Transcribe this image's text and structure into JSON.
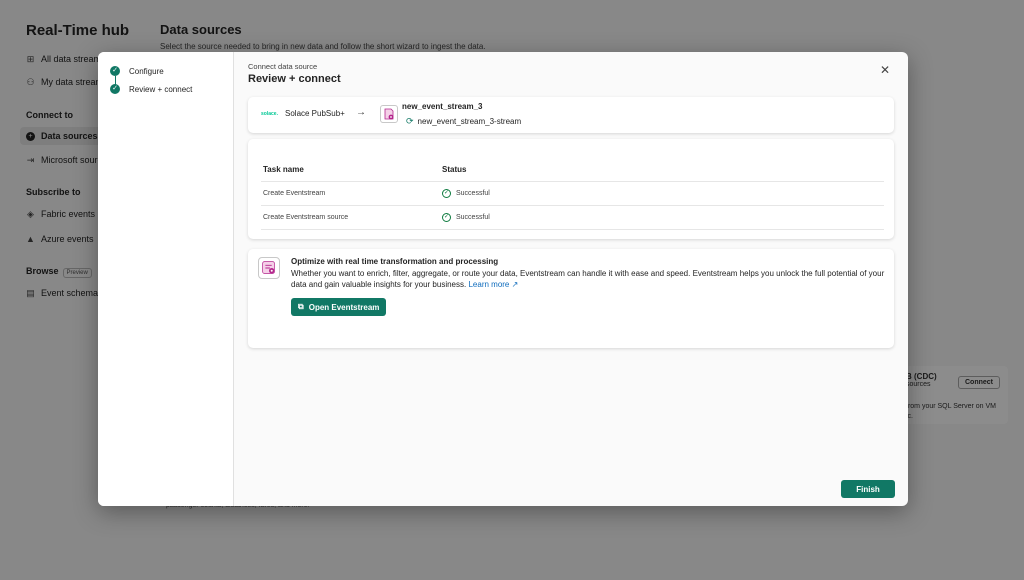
{
  "background": {
    "hub_title": "Real-Time hub",
    "nav": {
      "all_data_streams": "All data streams",
      "my_data_streams": "My data streams",
      "connect_to": "Connect to",
      "data_sources": "Data sources",
      "microsoft_sources": "Microsoft sources",
      "subscribe_to": "Subscribe to",
      "fabric_events": "Fabric events",
      "azure_events": "Azure events",
      "browse": "Browse",
      "preview_tag": "Preview",
      "event_schema": "Event schema re"
    },
    "page_title": "Data sources",
    "page_subtitle": "Select the source needed to bring in new data and follow the short wizard to ingest the data.",
    "card": {
      "title": "B (CDC)",
      "subtitle": "sources",
      "connect": "Connect",
      "desc_line1": "from your SQL Server on VM",
      "desc_line2": "ic."
    },
    "snippet": "passenger counts, distances, fares, and more."
  },
  "dialog": {
    "steps": [
      "Configure",
      "Review + connect"
    ],
    "kicker": "Connect data source",
    "title": "Review + connect",
    "source": {
      "logo_text": "solace.",
      "name": "Solace PubSub+"
    },
    "destination": {
      "name": "new_event_stream_3",
      "stream": "new_event_stream_3-stream"
    },
    "tasks": {
      "headers": [
        "Task name",
        "Status"
      ],
      "rows": [
        {
          "name": "Create Eventstream",
          "status": "Successful"
        },
        {
          "name": "Create Eventstream source",
          "status": "Successful"
        }
      ]
    },
    "optimize": {
      "title": "Optimize with real time transformation and processing",
      "desc": "Whether you want to enrich, filter, aggregate, or route your data, Eventstream can handle it with ease and speed. Eventstream helps you unlock the full potential of your data and gain valuable insights for your business.",
      "learn_more": "Learn more",
      "button": "Open Eventstream"
    },
    "finish": "Finish"
  },
  "colors": {
    "accent": "#117865",
    "link": "#0f6cbd",
    "success": "#107c41"
  }
}
